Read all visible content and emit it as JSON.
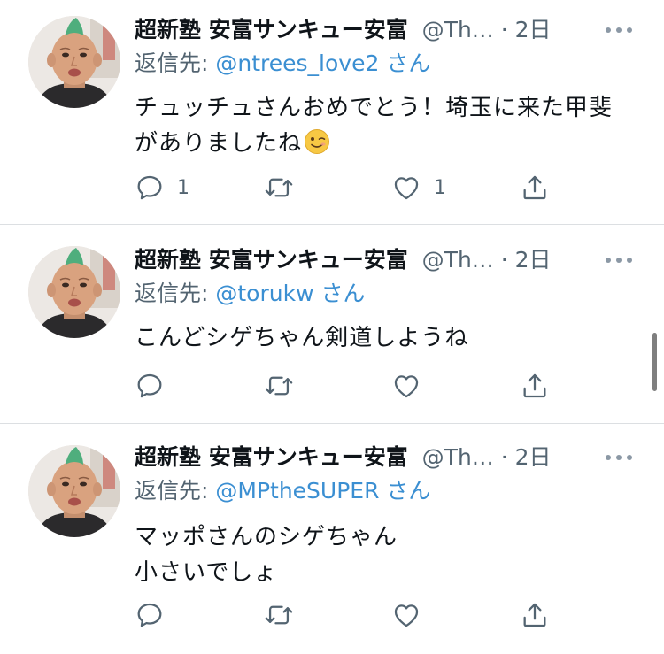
{
  "tweets": [
    {
      "author_name": "超新塾 安富サンキュー安富",
      "handle": "@Th…",
      "separator": "·",
      "time": "2日",
      "reply_prefix": "返信先: ",
      "reply_to": "@ntrees_love2",
      "reply_suffix": " さん",
      "text": "チュッチュさんおめでとう！埼玉に来た甲斐\nがありましたね",
      "emoji": "winking-face",
      "reply_count": "1",
      "retweet_count": "",
      "like_count": "1"
    },
    {
      "author_name": "超新塾 安富サンキュー安富",
      "handle": "@Th…",
      "separator": "·",
      "time": "2日",
      "reply_prefix": "返信先: ",
      "reply_to": "@torukw",
      "reply_suffix": " さん",
      "text": "こんどシゲちゃん剣道しようね",
      "reply_count": "",
      "retweet_count": "",
      "like_count": ""
    },
    {
      "author_name": "超新塾 安富サンキュー安富",
      "handle": "@Th…",
      "separator": "·",
      "time": "2日",
      "reply_prefix": "返信先: ",
      "reply_to": "@MPtheSUPER",
      "reply_suffix": " さん",
      "text": "マッポさんのシゲちゃん\n小さいでしょ",
      "reply_count": "",
      "retweet_count": "",
      "like_count": ""
    }
  ],
  "icons": {
    "reply": "speech-bubble-icon",
    "retweet": "retweet-arrows-icon",
    "like": "heart-outline-icon",
    "share": "share-upload-icon",
    "more": "more-horizontal-icon"
  },
  "colors": {
    "mention": "#3b8fd2",
    "secondary_text": "#536471",
    "divider": "#dcdfe2",
    "mohawk": "#4fae7d"
  }
}
